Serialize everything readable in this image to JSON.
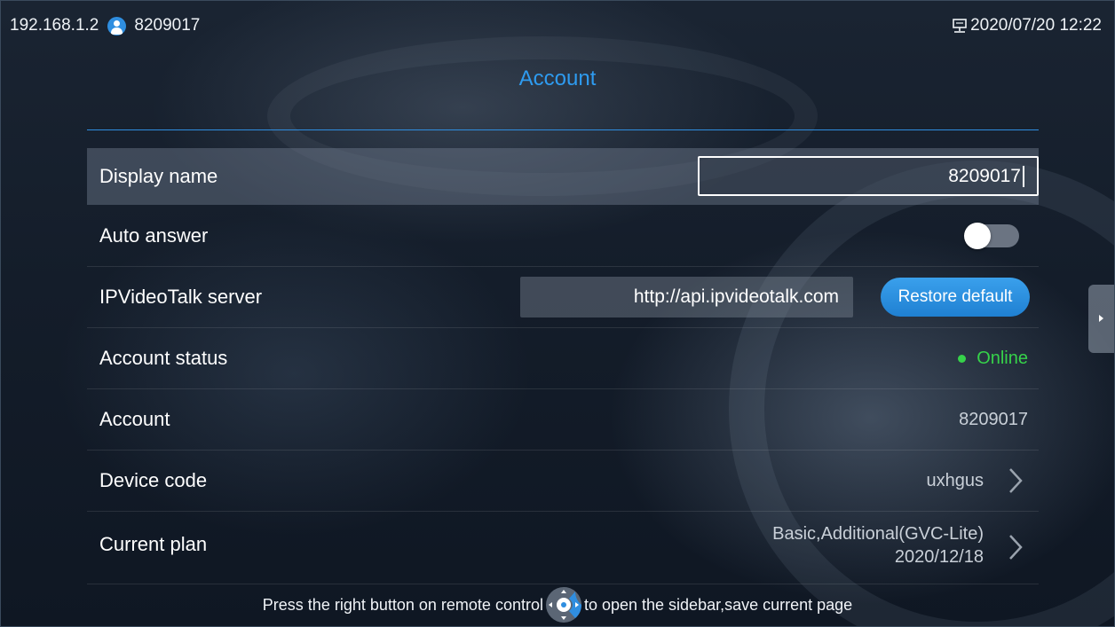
{
  "statusbar": {
    "ip": "192.168.1.2",
    "user_icon": "user-icon",
    "account_number": "8209017",
    "network_icon": "ethernet-icon",
    "datetime": "2020/07/20 12:22"
  },
  "page": {
    "title": "Account"
  },
  "settings": {
    "display_name": {
      "label": "Display name",
      "value": "8209017"
    },
    "auto_answer": {
      "label": "Auto answer",
      "enabled": false
    },
    "server": {
      "label": "IPVideoTalk server",
      "value": "http://api.ipvideotalk.com",
      "restore_label": "Restore default"
    },
    "account_status": {
      "label": "Account status",
      "value": "Online"
    },
    "account": {
      "label": "Account",
      "value": "8209017"
    },
    "device_code": {
      "label": "Device code",
      "value": "uxhgus"
    },
    "current_plan": {
      "label": "Current plan",
      "value_line1": "Basic,Additional(GVC-Lite)",
      "value_line2": "2020/12/18"
    }
  },
  "hint": {
    "before": "Press the right button on remote control",
    "after": "to open the sidebar,save current page",
    "icon": "remote-dpad-icon"
  },
  "colors": {
    "accent": "#2e9bf0",
    "online": "#36d24a",
    "button": "#1f80d2"
  }
}
